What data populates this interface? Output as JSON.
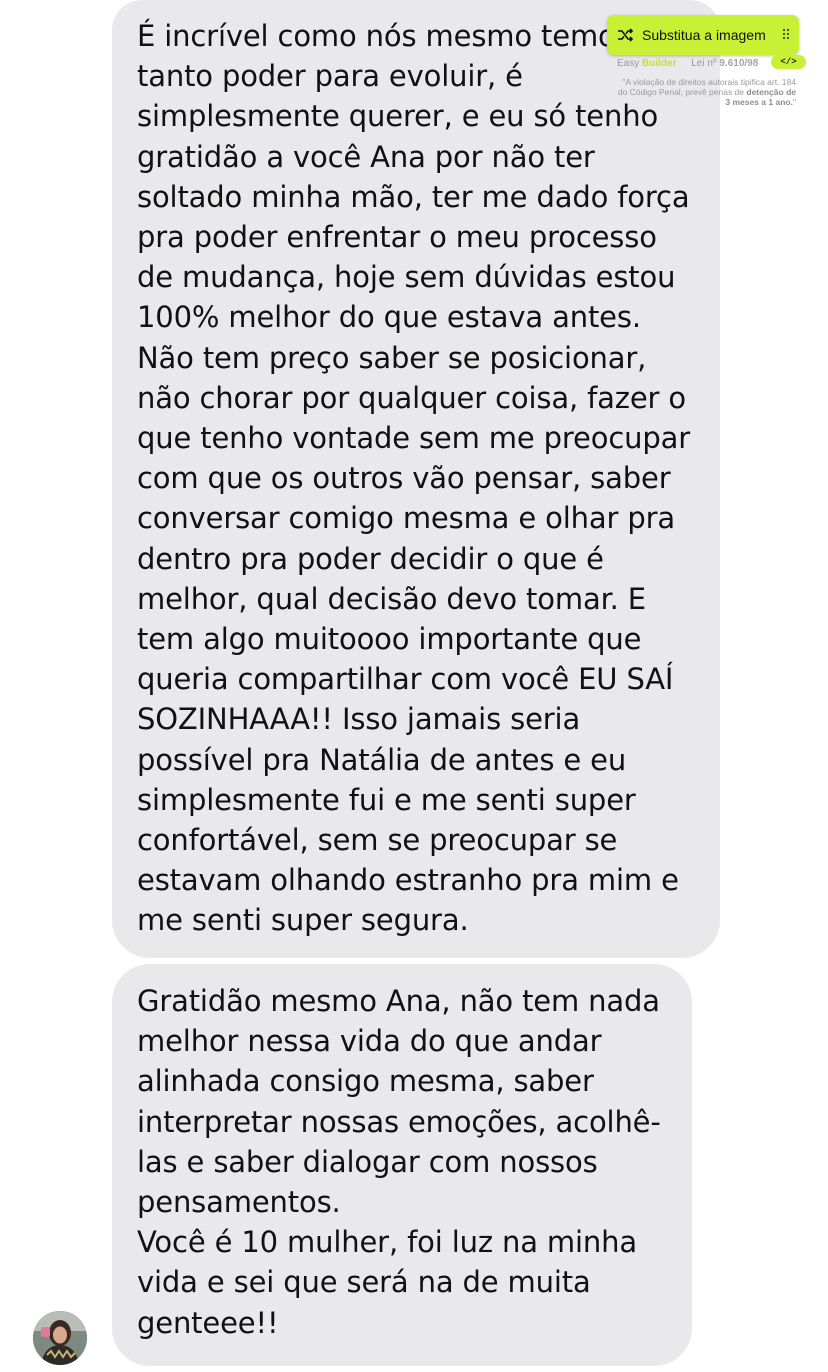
{
  "messages": [
    {
      "lines": [
        "É incrível como nós mesmo temos",
        "tanto poder para evoluir, é",
        "simplesmente querer, e eu só tenho",
        "gratidão a você Ana por não ter",
        "soltado minha mão, ter me dado força",
        "pra poder enfrentar o meu processo",
        "de mudança, hoje sem dúvidas estou",
        "100% melhor do que estava antes.",
        "Não tem preço saber se posicionar,",
        "não chorar por qualquer coisa, fazer o",
        "que tenho vontade sem me preocupar",
        "com que os outros vão pensar, saber",
        "conversar comigo mesma e olhar pra",
        "dentro pra poder decidir o que é",
        "melhor, qual decisão devo tomar. E",
        "tem algo muitoooo importante que",
        "queria compartilhar com você EU SAÍ",
        "SOZINHAAA!! Isso jamais seria",
        "possível pra Natália de antes e eu",
        "simplesmente fui e me senti super",
        "confortável, sem se preocupar se",
        "estavam olhando estranho pra mim e",
        "me senti super segura."
      ]
    },
    {
      "lines": [
        "Gratidão mesmo Ana, não tem nada",
        "melhor nessa vida do que andar",
        "alinhada consigo mesma, saber",
        "interpretar nossas emoções, acolhê-",
        "las e saber dialogar com nossos",
        "pensamentos.",
        "Você é 10 mulher, foi luz na minha",
        "vida e sei que será na de muita",
        "genteee!!"
      ]
    }
  ],
  "overlay": {
    "button_label": "Substitua a imagem",
    "brand_prefix": "Easy",
    "brand_accent": "Builder",
    "law_prefix": "Lei nº",
    "law_number": "9.610/98",
    "code_label": "</>",
    "note_part1": "\"A violação de direitos autorais tipifica art. 184 do Código Penal, prevê penas de",
    "note_strong": "detenção de 3 meses a 1 ano.",
    "note_end": "\"",
    "accent_color": "#c8f135"
  },
  "colors": {
    "bubble_background": "#e9e9eb",
    "text": "#111111"
  },
  "icons": {
    "avatar": "avatar",
    "shuffle": "shuffle-icon",
    "drag": "drag-handle-icon"
  }
}
